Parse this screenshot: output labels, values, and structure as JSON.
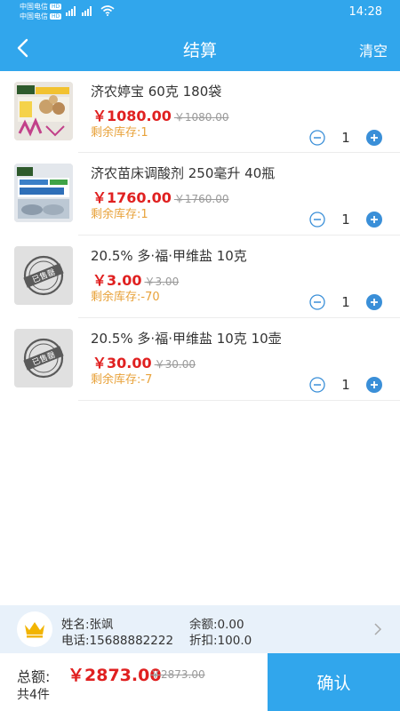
{
  "status_bar": {
    "carrier1": "中国电信",
    "carrier2": "中国电信",
    "hd": "HD",
    "time": "14:28"
  },
  "nav": {
    "title": "结算",
    "clear": "清空"
  },
  "items": [
    {
      "name": "济农婷宝 60克  180袋",
      "price": "￥1080.00",
      "original": "￥1080.00",
      "stock": "剩余库存:1",
      "qty": "1"
    },
    {
      "name": "济农苗床调酸剂 250毫升  40瓶",
      "price": "￥1760.00",
      "original": "￥1760.00",
      "stock": "剩余库存:1",
      "qty": "1"
    },
    {
      "name": "20.5% 多·福·甲维盐 10克",
      "price": "￥3.00",
      "original": "￥3.00",
      "stock": "剩余库存:-70",
      "qty": "1"
    },
    {
      "name": "20.5% 多·福·甲维盐 10克  10壶",
      "price": "￥30.00",
      "original": "￥30.00",
      "stock": "剩余库存:-7",
      "qty": "1"
    }
  ],
  "placeholder_stamp": "已售罄",
  "member": {
    "name": "姓名:张飒",
    "phone": "电话:15688882222",
    "balance": "余额:0.00",
    "discount": "折扣:100.0"
  },
  "checkout": {
    "total_label": "总额:",
    "total": "￥2873.00",
    "total_original": "￥2873.00",
    "count": "共4件",
    "confirm": "确认"
  },
  "colors": {
    "primary": "#31a6ec",
    "price": "#e02020",
    "stock": "#e8a23a",
    "member_bg": "#e8f1fa"
  }
}
